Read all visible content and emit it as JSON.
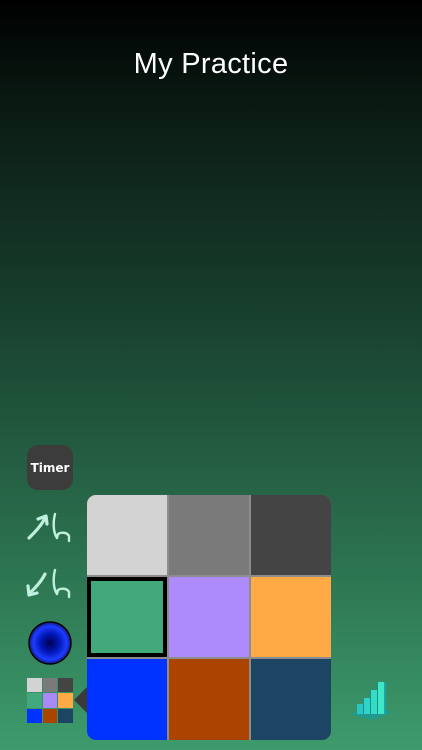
{
  "header": {
    "title": "My Practice"
  },
  "toolbar": {
    "timer_label": "Timer",
    "icons": [
      "arrow-up-curve-icon",
      "arrow-down-curve-icon",
      "blue-circle-icon",
      "color-grid-icon",
      "bar-chart-icon"
    ]
  },
  "mini_grid": {
    "colors": [
      "#d3d3d3",
      "#7a7a7a",
      "#444444",
      "#41a97b",
      "#a989f7",
      "#ffaa44",
      "#0033ff",
      "#ab4400",
      "#1c4563"
    ]
  },
  "palette": {
    "selected_index": 3,
    "swatches": [
      {
        "name": "light-gray",
        "color": "#d3d3d3"
      },
      {
        "name": "gray",
        "color": "#7a7a7a"
      },
      {
        "name": "dark-gray",
        "color": "#444444"
      },
      {
        "name": "green",
        "color": "#41a97b"
      },
      {
        "name": "lavender",
        "color": "#ad8bfc"
      },
      {
        "name": "orange",
        "color": "#ffaa44"
      },
      {
        "name": "blue",
        "color": "#0033ff"
      },
      {
        "name": "rust",
        "color": "#ab4400"
      },
      {
        "name": "navy",
        "color": "#1c4563"
      }
    ]
  },
  "colors": {
    "accent_icon": "#bff0de",
    "circle_center": "#000050",
    "circle_edge": "#1f3cff"
  }
}
